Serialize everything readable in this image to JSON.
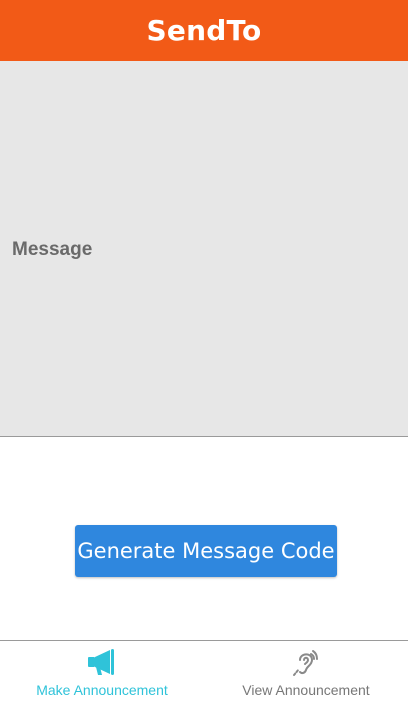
{
  "header": {
    "title": "SendTo"
  },
  "message": {
    "label": "Message"
  },
  "actions": {
    "generate_label": "Generate Message Code"
  },
  "tabs": [
    {
      "label": "Make Announcement",
      "icon": "megaphone-icon",
      "active": true
    },
    {
      "label": "View Announcement",
      "icon": "hearing-icon",
      "active": false
    }
  ],
  "colors": {
    "header": "#f25a17",
    "button": "#2f87de",
    "active_tab": "#2fc3d9",
    "inactive_tab": "#777777",
    "message_bg": "#e7e7e7"
  }
}
